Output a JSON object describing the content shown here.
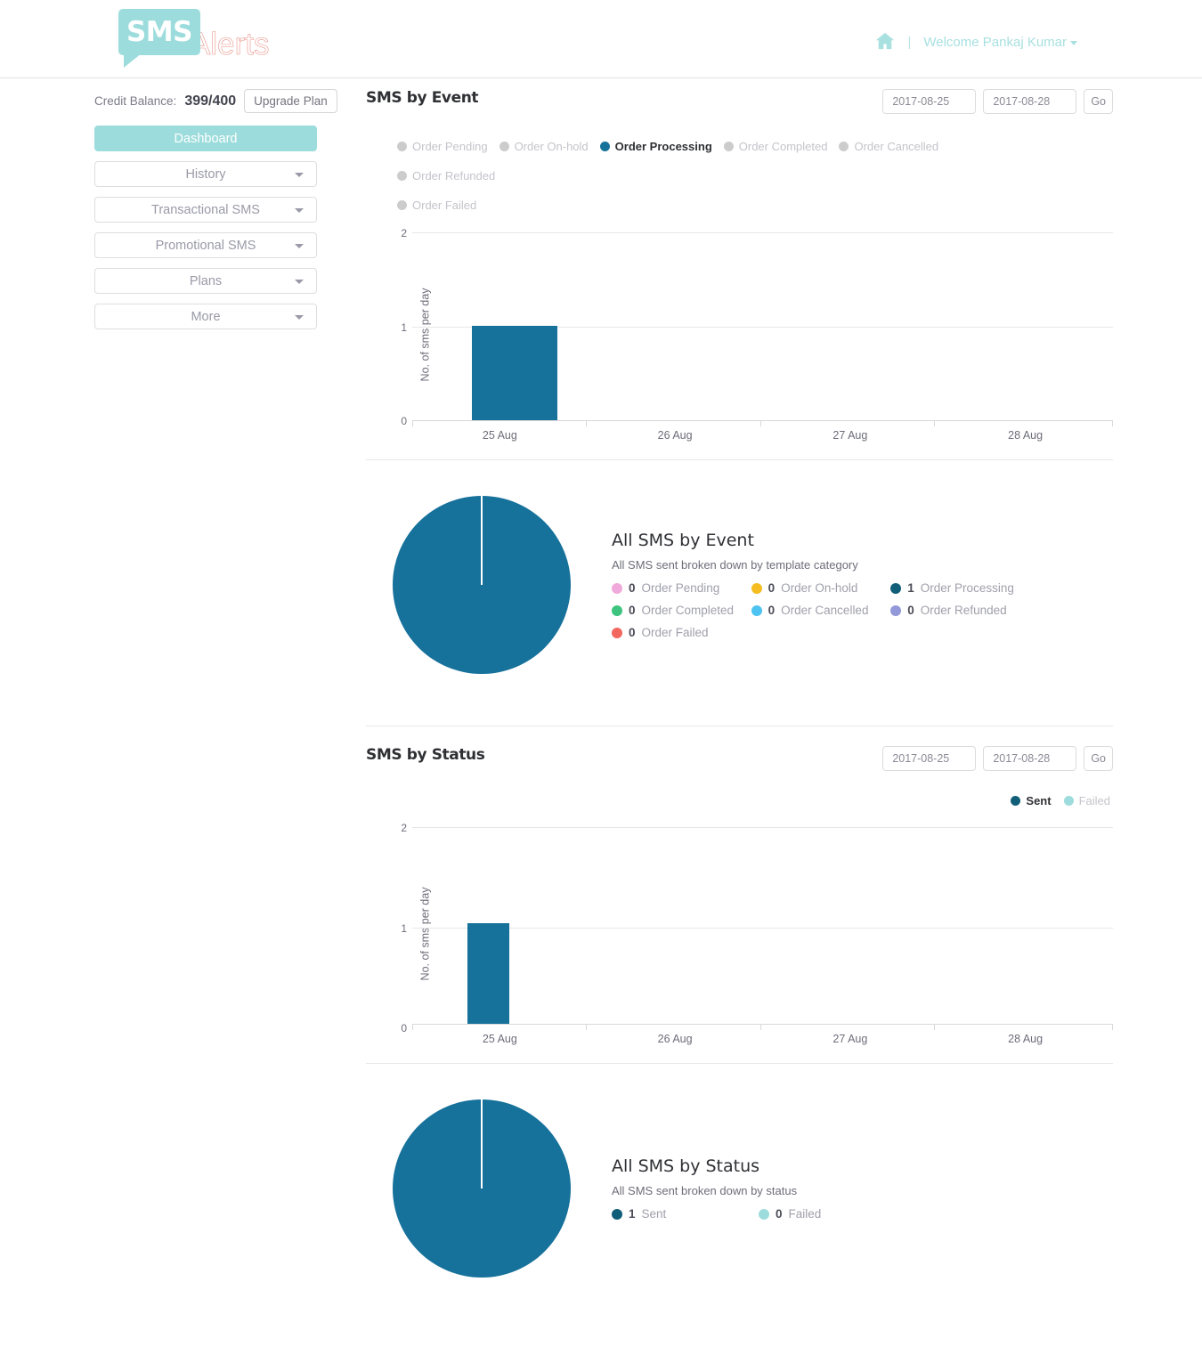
{
  "header": {
    "logo_primary": "SMS",
    "logo_secondary": "Alerts",
    "home_icon": "home-icon",
    "separator": "|",
    "welcome": "Welcome Pankaj Kumar"
  },
  "sidebar": {
    "credit_label": "Credit Balance:",
    "credit_value": "399/400",
    "upgrade_label": "Upgrade Plan",
    "items": [
      {
        "label": "Dashboard",
        "active": true,
        "caret": false
      },
      {
        "label": "History",
        "active": false,
        "caret": true
      },
      {
        "label": "Transactional SMS",
        "active": false,
        "caret": true
      },
      {
        "label": "Promotional SMS",
        "active": false,
        "caret": true
      },
      {
        "label": "Plans",
        "active": false,
        "caret": true
      },
      {
        "label": "More",
        "active": false,
        "caret": true
      }
    ]
  },
  "event_panel": {
    "title": "SMS by Event",
    "date_from": "2017-08-25",
    "date_to": "2017-08-28",
    "go_label": "Go",
    "legend": [
      {
        "label": "Order Pending",
        "on": false
      },
      {
        "label": "Order On-hold",
        "on": false
      },
      {
        "label": "Order Processing",
        "on": true
      },
      {
        "label": "Order Completed",
        "on": false
      },
      {
        "label": "Order Cancelled",
        "on": false
      },
      {
        "label": "Order Refunded",
        "on": false
      },
      {
        "label": "Order Failed",
        "on": false
      }
    ]
  },
  "event_pie": {
    "title": "All SMS by Event",
    "subtitle": "All SMS sent broken down by template category",
    "legend": [
      {
        "value": "0",
        "label": "Order Pending",
        "color": "#efa9da"
      },
      {
        "value": "0",
        "label": "Order On-hold",
        "color": "#f5bd21"
      },
      {
        "value": "1",
        "label": "Order Processing",
        "color": "#115e78"
      },
      {
        "value": "0",
        "label": "Order Completed",
        "color": "#3ec47e"
      },
      {
        "value": "0",
        "label": "Order Cancelled",
        "color": "#4cc3f0"
      },
      {
        "value": "0",
        "label": "Order Refunded",
        "color": "#9398d8"
      },
      {
        "value": "0",
        "label": "Order Failed",
        "color": "#f2685f"
      }
    ]
  },
  "status_panel": {
    "title": "SMS by Status",
    "date_from": "2017-08-25",
    "date_to": "2017-08-28",
    "go_label": "Go",
    "legend": [
      {
        "label": "Sent",
        "on": true,
        "color": "#115e78"
      },
      {
        "label": "Failed",
        "on": false,
        "color": "#9ddcdc"
      }
    ]
  },
  "status_pie": {
    "title": "All SMS by Status",
    "subtitle": "All SMS sent broken down by status",
    "legend": [
      {
        "value": "1",
        "label": "Sent",
        "color": "#115e78"
      },
      {
        "value": "0",
        "label": "Failed",
        "color": "#9ddcdc"
      }
    ]
  },
  "chart_data": [
    {
      "type": "bar",
      "title": "SMS by Event",
      "categories": [
        "25 Aug",
        "26 Aug",
        "27 Aug",
        "28 Aug"
      ],
      "series": [
        {
          "name": "Order Pending",
          "values": [
            0,
            0,
            0,
            0
          ],
          "visible": false
        },
        {
          "name": "Order On-hold",
          "values": [
            0,
            0,
            0,
            0
          ],
          "visible": false
        },
        {
          "name": "Order Processing",
          "values": [
            1,
            0,
            0,
            0
          ],
          "visible": true
        },
        {
          "name": "Order Completed",
          "values": [
            0,
            0,
            0,
            0
          ],
          "visible": false
        },
        {
          "name": "Order Cancelled",
          "values": [
            0,
            0,
            0,
            0
          ],
          "visible": false
        },
        {
          "name": "Order Refunded",
          "values": [
            0,
            0,
            0,
            0
          ],
          "visible": false
        },
        {
          "name": "Order Failed",
          "values": [
            0,
            0,
            0,
            0
          ],
          "visible": false
        }
      ],
      "xlabel": "",
      "ylabel": "No. of sms per day",
      "ylim": [
        0,
        2
      ],
      "yticks": [
        0,
        1,
        2
      ],
      "grid": true,
      "legend_position": "top",
      "bar_color": "#16719b"
    },
    {
      "type": "pie",
      "title": "All SMS by Event",
      "subtitle": "All SMS sent broken down by template category",
      "labels": [
        "Order Pending",
        "Order On-hold",
        "Order Processing",
        "Order Completed",
        "Order Cancelled",
        "Order Refunded",
        "Order Failed"
      ],
      "values": [
        0,
        0,
        1,
        0,
        0,
        0,
        0
      ],
      "colors": [
        "#efa9da",
        "#f5bd21",
        "#115e78",
        "#3ec47e",
        "#4cc3f0",
        "#9398d8",
        "#f2685f"
      ],
      "legend_position": "right"
    },
    {
      "type": "bar",
      "title": "SMS by Status",
      "categories": [
        "25 Aug",
        "26 Aug",
        "27 Aug",
        "28 Aug"
      ],
      "series": [
        {
          "name": "Sent",
          "values": [
            1,
            0,
            0,
            0
          ],
          "visible": true
        },
        {
          "name": "Failed",
          "values": [
            0,
            0,
            0,
            0
          ],
          "visible": true
        }
      ],
      "xlabel": "",
      "ylabel": "No. of sms per day",
      "ylim": [
        0,
        2
      ],
      "yticks": [
        0,
        1,
        2
      ],
      "grid": true,
      "legend_position": "top-right",
      "bar_color": "#16719b"
    },
    {
      "type": "pie",
      "title": "All SMS by Status",
      "subtitle": "All SMS sent broken down by status",
      "labels": [
        "Sent",
        "Failed"
      ],
      "values": [
        1,
        0
      ],
      "colors": [
        "#115e78",
        "#9ddcdc"
      ],
      "legend_position": "right"
    }
  ]
}
